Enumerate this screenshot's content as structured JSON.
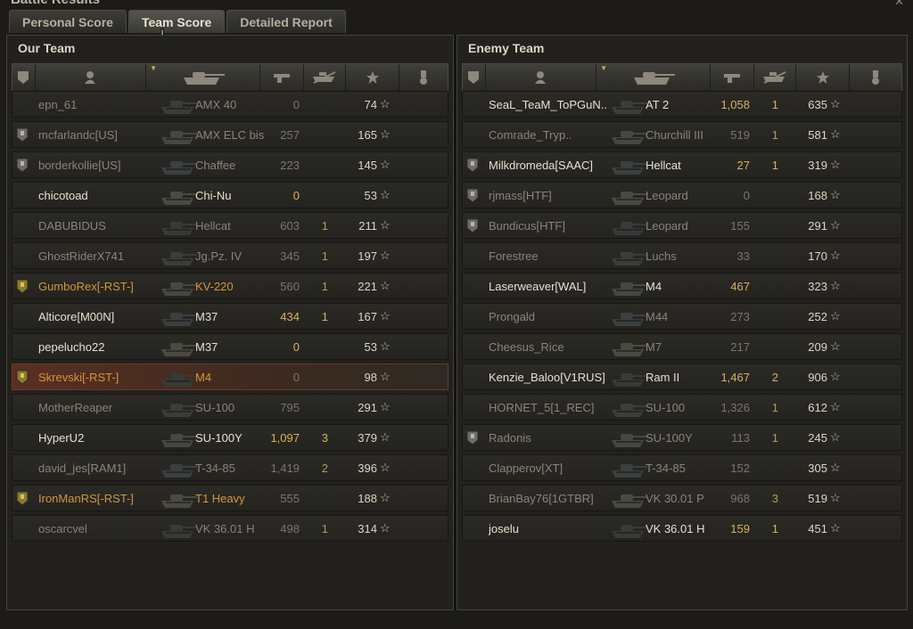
{
  "window": {
    "title": "Battle Results"
  },
  "tabs": [
    "Personal Score",
    "Team Score",
    "Detailed Report"
  ],
  "active_tab": 1,
  "our_team": {
    "title": "Our Team",
    "rows": [
      {
        "name": "epn_61",
        "tank": "AMX 40",
        "damage": "0",
        "kills": "",
        "xp": "74",
        "status": "dead",
        "badge": false
      },
      {
        "name": "mcfarlandc[US]",
        "tank": "AMX ELC bis",
        "damage": "257",
        "kills": "",
        "xp": "165",
        "status": "dead",
        "badge": true
      },
      {
        "name": "borderkollie[US]",
        "tank": "Chaffee",
        "damage": "223",
        "kills": "",
        "xp": "145",
        "status": "dead",
        "badge": true
      },
      {
        "name": "chicotoad",
        "tank": "Chi-Nu",
        "damage": "0",
        "kills": "",
        "xp": "53",
        "status": "alive",
        "badge": false
      },
      {
        "name": "DABUBIDUS",
        "tank": "Hellcat",
        "damage": "603",
        "kills": "1",
        "xp": "211",
        "status": "dead",
        "badge": false
      },
      {
        "name": "GhostRiderX741",
        "tank": "Jg.Pz. IV",
        "damage": "345",
        "kills": "1",
        "xp": "197",
        "status": "dead",
        "badge": false
      },
      {
        "name": "GumboRex[-RST-]",
        "tank": "KV-220",
        "damage": "560",
        "kills": "1",
        "xp": "221",
        "status": "platoon",
        "badge": true
      },
      {
        "name": "Alticore[M00N]",
        "tank": "M37",
        "damage": "434",
        "kills": "1",
        "xp": "167",
        "status": "alive",
        "badge": false
      },
      {
        "name": "pepelucho22",
        "tank": "M37",
        "damage": "0",
        "kills": "",
        "xp": "53",
        "status": "alive",
        "badge": false
      },
      {
        "name": "Skrevski[-RST-]",
        "tank": "M4",
        "damage": "0",
        "kills": "",
        "xp": "98",
        "status": "self",
        "badge": true
      },
      {
        "name": "MotherReaper",
        "tank": "SU-100",
        "damage": "795",
        "kills": "",
        "xp": "291",
        "status": "dead",
        "badge": false
      },
      {
        "name": "HyperU2",
        "tank": "SU-100Y",
        "damage": "1,097",
        "kills": "3",
        "xp": "379",
        "status": "alive",
        "badge": false
      },
      {
        "name": "david_jes[RAM1]",
        "tank": "T-34-85",
        "damage": "1,419",
        "kills": "2",
        "xp": "396",
        "status": "dead",
        "badge": false
      },
      {
        "name": "IronManRS[-RST-]",
        "tank": "T1 Heavy",
        "damage": "555",
        "kills": "",
        "xp": "188",
        "status": "platoon",
        "badge": true
      },
      {
        "name": "oscarcvel",
        "tank": "VK 36.01 H",
        "damage": "498",
        "kills": "1",
        "xp": "314",
        "status": "dead",
        "badge": false
      }
    ]
  },
  "enemy_team": {
    "title": "Enemy Team",
    "rows": [
      {
        "name": "SeaL_TeaM_ToPGuN..",
        "tank": "AT 2",
        "damage": "1,058",
        "kills": "1",
        "xp": "635",
        "status": "alive",
        "badge": false
      },
      {
        "name": "Comrade_Tryp..",
        "tank": "Churchill III",
        "damage": "519",
        "kills": "1",
        "xp": "581",
        "status": "dead",
        "badge": false
      },
      {
        "name": "Milkdromeda[SAAC]",
        "tank": "Hellcat",
        "damage": "27",
        "kills": "1",
        "xp": "319",
        "status": "alive",
        "badge": true
      },
      {
        "name": "rjmass[HTF]",
        "tank": "Leopard",
        "damage": "0",
        "kills": "",
        "xp": "168",
        "status": "dead",
        "badge": true
      },
      {
        "name": "Bundicus[HTF]",
        "tank": "Leopard",
        "damage": "155",
        "kills": "",
        "xp": "291",
        "status": "dead",
        "badge": true
      },
      {
        "name": "Forestree",
        "tank": "Luchs",
        "damage": "33",
        "kills": "",
        "xp": "170",
        "status": "dead",
        "badge": false
      },
      {
        "name": "Laserweaver[WAL]",
        "tank": "M4",
        "damage": "467",
        "kills": "",
        "xp": "323",
        "status": "alive",
        "badge": false
      },
      {
        "name": "Prongald",
        "tank": "M44",
        "damage": "273",
        "kills": "",
        "xp": "252",
        "status": "dead",
        "badge": false
      },
      {
        "name": "Cheesus_Rice",
        "tank": "M7",
        "damage": "217",
        "kills": "",
        "xp": "209",
        "status": "dead",
        "badge": false
      },
      {
        "name": "Kenzie_Baloo[V1RUS]",
        "tank": "Ram II",
        "damage": "1,467",
        "kills": "2",
        "xp": "906",
        "status": "alive",
        "badge": false
      },
      {
        "name": "HORNET_5[1_REC]",
        "tank": "SU-100",
        "damage": "1,326",
        "kills": "1",
        "xp": "612",
        "status": "dead",
        "badge": false
      },
      {
        "name": "Radonis",
        "tank": "SU-100Y",
        "damage": "113",
        "kills": "1",
        "xp": "245",
        "status": "dead",
        "badge": true
      },
      {
        "name": "Clapperov[XT]",
        "tank": "T-34-85",
        "damage": "152",
        "kills": "",
        "xp": "305",
        "status": "dead",
        "badge": false
      },
      {
        "name": "BrianBay76[1GTBR]",
        "tank": "VK 30.01 P",
        "damage": "968",
        "kills": "3",
        "xp": "519",
        "status": "dead",
        "badge": false
      },
      {
        "name": "joselu",
        "tank": "VK 36.01 H",
        "damage": "159",
        "kills": "1",
        "xp": "451",
        "status": "alive",
        "badge": false
      }
    ]
  },
  "icons": {
    "header": [
      "squad-icon",
      "player-icon",
      "tank-icon",
      "damage-icon",
      "kills-icon",
      "xp-star-icon",
      "medal-icon"
    ],
    "row_star": "star-icon"
  },
  "colors": {
    "alive": "#e6e0cf",
    "dead": "#8a8478",
    "platoon": "#d1973a",
    "number_gold": "#d9b25a"
  }
}
